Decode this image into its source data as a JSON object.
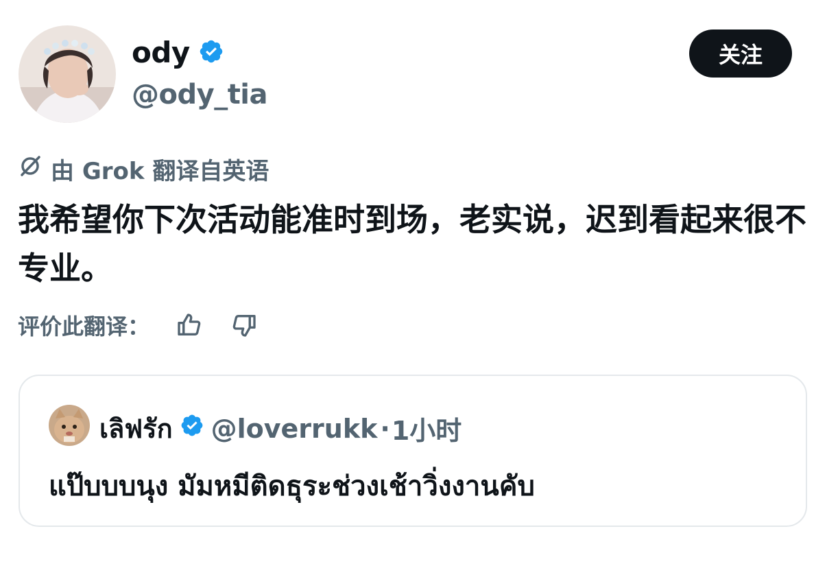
{
  "author": {
    "display_name": "ody",
    "handle": "@ody_tia",
    "verified": true,
    "avatar_icon": "user-avatar"
  },
  "follow_label": "关注",
  "translation": {
    "label": "由 Grok 翻译自英语",
    "icon": "grok-icon"
  },
  "tweet_text": "我希望你下次活动能准时到场，老实说，迟到看起来很不专业。",
  "rate": {
    "label": "评价此翻译：",
    "like_icon": "thumbs-up-icon",
    "dislike_icon": "thumbs-down-icon"
  },
  "quoted": {
    "display_name": "เลิฟรัก",
    "handle": "@loverrukk",
    "separator": "·",
    "time": "1小时",
    "text": "แป๊บบบนุง มัมหมีติดธุระช่วงเช้าวิ่งงานคับ",
    "verified": true
  },
  "colors": {
    "verified_blue": "#1d9bf0",
    "secondary_text": "#536471",
    "primary_text": "#0f1419",
    "button_bg": "#0f1419",
    "border": "#e4e8eb"
  }
}
